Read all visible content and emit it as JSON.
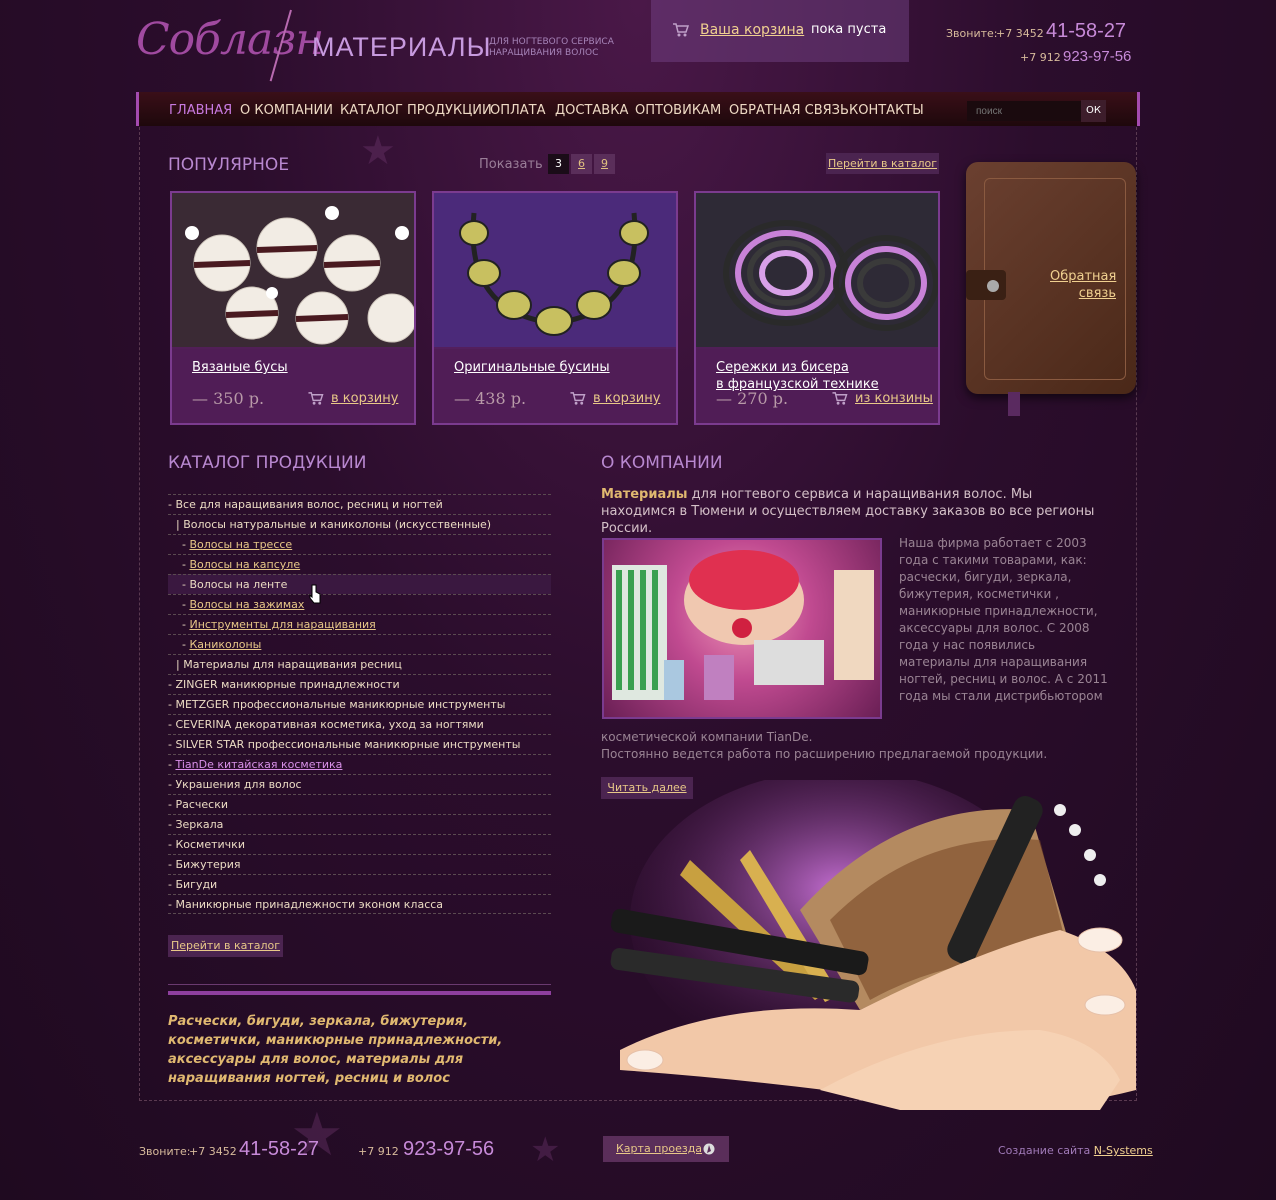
{
  "header": {
    "logo_script": "Соблазн",
    "logo_main": "МАТЕРИАЛЫ",
    "logo_sub_1": "ДЛЯ НОГТЕВОГО СЕРВИСА",
    "logo_sub_2": "НАРАЩИВАНИЯ ВОЛОС",
    "cart_link": "Ваша корзина",
    "cart_dash": "-",
    "cart_status": "пока пуста",
    "call_label": "Звоните:",
    "phone1_code": "+7  3452",
    "phone1_number": "41-58-27",
    "phone2_code": "+7  912",
    "phone2_number": "923-97-56"
  },
  "nav": {
    "items": [
      "ГЛАВНАЯ",
      "О КОМПАНИИ",
      "КАТАЛОГ ПРОДУКЦИИ",
      "ОПЛАТА",
      "ДОСТАВКА",
      "ОПТОВИКАМ",
      "ОБРАТНАЯ СВЯЗЬ",
      "КОНТАКТЫ"
    ],
    "search_placeholder": "поиск",
    "search_button": "ОК"
  },
  "popular": {
    "title": "ПОПУЛЯРНОЕ",
    "show_label": "Показать",
    "pages": [
      "3",
      "6",
      "9"
    ],
    "goto_catalog": "Перейти в каталог",
    "products": [
      {
        "name_1": "Вязаные бусы",
        "name_2": "",
        "price": "— 350 р.",
        "action": "в корзину"
      },
      {
        "name_1": "Оригинальные бусины",
        "name_2": "",
        "price": "— 438 р.",
        "action": "в корзину"
      },
      {
        "name_1": "Сережки из бисера",
        "name_2": "в французской технике",
        "price": "— 270 р.",
        "action": "из конзины"
      }
    ]
  },
  "feedback": {
    "line1": "Обратная",
    "line2": "связь"
  },
  "catalog": {
    "title": "КАТАЛОГ ПРОДУКЦИИ",
    "rows": [
      {
        "prefix": "- ",
        "text": "Все для наращивания волос, ресниц и ногтей",
        "link": false
      },
      {
        "prefix": "| ",
        "text": "Волосы натуральные  и каниколоны (искусственные)",
        "link": false
      },
      {
        "prefix": "- ",
        "text": "Волосы на трессе",
        "link": true
      },
      {
        "prefix": "- ",
        "text": "Волосы на капсуле",
        "link": true
      },
      {
        "prefix": "- ",
        "text": "Волосы на ленте",
        "link": false
      },
      {
        "prefix": "- ",
        "text": "Волосы на зажимах",
        "link": true
      },
      {
        "prefix": "- ",
        "text": "Инструменты для наращивания",
        "link": true
      },
      {
        "prefix": "- ",
        "text": "Каниколоны",
        "link": true
      },
      {
        "prefix": "| ",
        "text": "Материалы для наращивания ресниц",
        "link": false
      },
      {
        "prefix": "- ",
        "text": "ZINGER маникюрные принадлежности",
        "link": false
      },
      {
        "prefix": "- ",
        "text": "METZGER  профессиональные маникюрные инструменты",
        "link": false
      },
      {
        "prefix": "- ",
        "text": "CEVERINA декоративная косметика, уход за ногтями",
        "link": false
      },
      {
        "prefix": "- ",
        "text": "SILVER STAR профессиональные маникюрные инструменты",
        "link": false
      },
      {
        "prefix": "- ",
        "text": "TianDe китайская косметика",
        "link": true
      },
      {
        "prefix": "- ",
        "text": "Украшения для волос",
        "link": false
      },
      {
        "prefix": "- ",
        "text": "Расчески",
        "link": false
      },
      {
        "prefix": "- ",
        "text": "Зеркала",
        "link": false
      },
      {
        "prefix": "- ",
        "text": "Косметички",
        "link": false
      },
      {
        "prefix": "- ",
        "text": "Бижутерия",
        "link": false
      },
      {
        "prefix": "- ",
        "text": "Бигуди",
        "link": false
      },
      {
        "prefix": "- ",
        "text": "Маникюрные принадлежности эконом класса",
        "link": false
      }
    ],
    "goto_catalog": "Перейти в каталог",
    "tagline": "Расчески, бигуди, зеркала, бижутерия, косметички, маникюрные принадлежности, аксессуары для волос, материалы для наращивания ногтей, ресниц и волос"
  },
  "about": {
    "title": "О КОМПАНИИ",
    "intro_bold": "Материалы",
    "intro_rest": " для ногтевого сервиса и наращивания волос. Мы находимся в Тюмени и осуществляем доставку заказов во все регионы России.",
    "text": "Наша фирма работает с 2003 года с такими товарами, как: расчески, бигуди, зеркала, бижутерия, косметички , маникюрные принадлежности, аксессуары для волос. С 2008 года у нас появились материалы для наращивания ногтей, ресниц и волос. А с 2011 года мы стали дистрибьютором",
    "text2_line1": "косметической компании TianDe.",
    "text2_line2": "Постоянно ведется работа по расширению предлагаемой продукции.",
    "read_more": "Читать далее"
  },
  "footer": {
    "call_label": "Звоните:",
    "phone1_code": "+7  3452",
    "phone1_number": "41-58-27",
    "phone2_code": "+7  912",
    "phone2_number": "923-97-56",
    "map_link": "Карта проезда",
    "credit_label": "Создание сайта",
    "credit_link": "N-Systems"
  },
  "colors": {
    "accent": "#a44bb0",
    "link": "#e8c888",
    "background": "#2b0d2c"
  }
}
